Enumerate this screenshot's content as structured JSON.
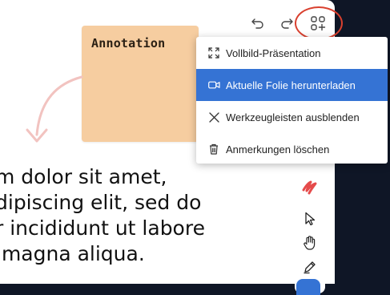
{
  "canvas": {
    "sticky_note": {
      "text": "Annotation",
      "color": "#f6cda0"
    },
    "body_lines": [
      "m dolor sit amet,",
      "dipiscing elit, sed do",
      "r incididunt ut labore",
      " magna aliqua."
    ],
    "arrow_color": "#f2c3c0"
  },
  "topbar": {
    "undo_icon": "undo-icon",
    "redo_icon": "redo-icon",
    "more_icon": "apps-add-icon",
    "highlight_color": "#d9402f"
  },
  "menu": {
    "items": [
      {
        "label": "Vollbild-Präsentation",
        "icon": "fullscreen-icon"
      },
      {
        "label": "Aktuelle Folie herunterladen",
        "icon": "video-camera-icon",
        "active": true
      },
      {
        "label": "Werkzeugleisten ausblenden",
        "icon": "close-icon"
      },
      {
        "label": "Anmerkungen löschen",
        "icon": "trash-icon"
      }
    ],
    "active_color": "#3573d4"
  },
  "toolbar": {
    "tools": [
      "clear-annotations-icon",
      "pointer-icon",
      "hand-icon",
      "pen-icon"
    ],
    "accent": "#e54b4b"
  }
}
